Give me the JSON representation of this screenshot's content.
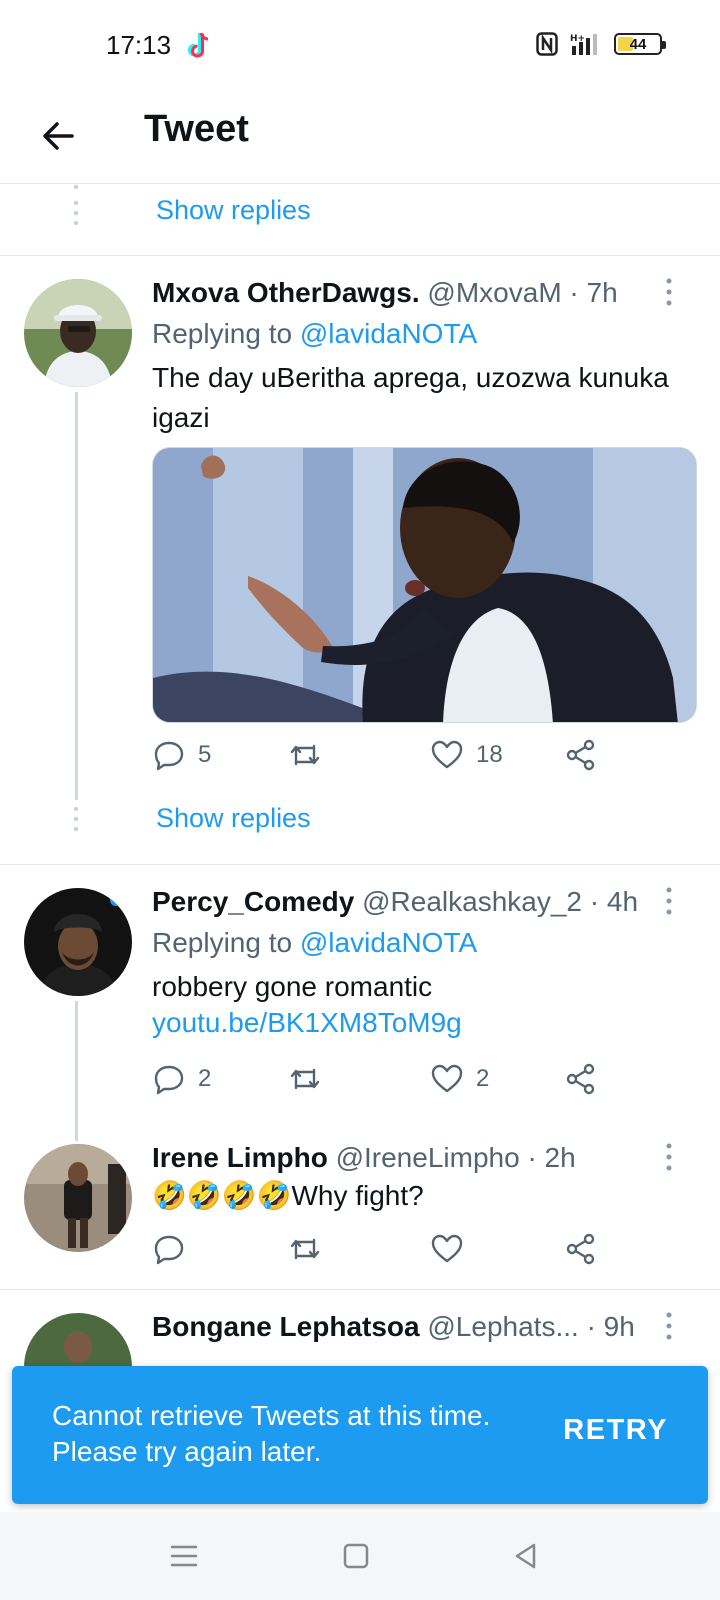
{
  "status_bar": {
    "time": "17:13",
    "battery": "44",
    "battery_level": 0.44,
    "icons": [
      "tiktok-icon",
      "nfc-icon",
      "signal-icon",
      "battery-icon"
    ]
  },
  "header": {
    "title": "Tweet"
  },
  "thread": {
    "show_replies_label": "Show replies"
  },
  "tweets": [
    {
      "name": "Mxova OtherDawgs.",
      "handle": "@MxovaM",
      "time": "· 7h",
      "replying_prefix": "Replying to",
      "replying_to": "@lavidaNOTA",
      "text": "The day uBeritha aprega, uzozwa kunuka igazi",
      "replies": "5",
      "retweets": "",
      "likes": "18",
      "show_replies": "Show replies"
    },
    {
      "name": "Percy_Comedy",
      "handle": "@Realkashkay_2",
      "time": "· 4h",
      "replying_prefix": "Replying to",
      "replying_to": "@lavidaNOTA",
      "text": "robbery gone romantic",
      "link": "youtu.be/BK1XM8ToM9g",
      "replies": "2",
      "retweets": "",
      "likes": "2"
    },
    {
      "name": "Irene Limpho",
      "handle": "@IreneLimpho",
      "time": "· 2h",
      "text": "🤣🤣🤣🤣Why fight?",
      "replies": "",
      "retweets": "",
      "likes": ""
    },
    {
      "name": "Bongane Lephatsoa",
      "handle": "@Lephats...",
      "time": "· 9h"
    }
  ],
  "snackbar": {
    "message": "Cannot retrieve Tweets at this time. Please try again later.",
    "action": "RETRY",
    "color": "#1d9bf0"
  },
  "colors": {
    "accent": "#1d9bf0",
    "text": "#0f1419",
    "secondary": "#536471"
  }
}
